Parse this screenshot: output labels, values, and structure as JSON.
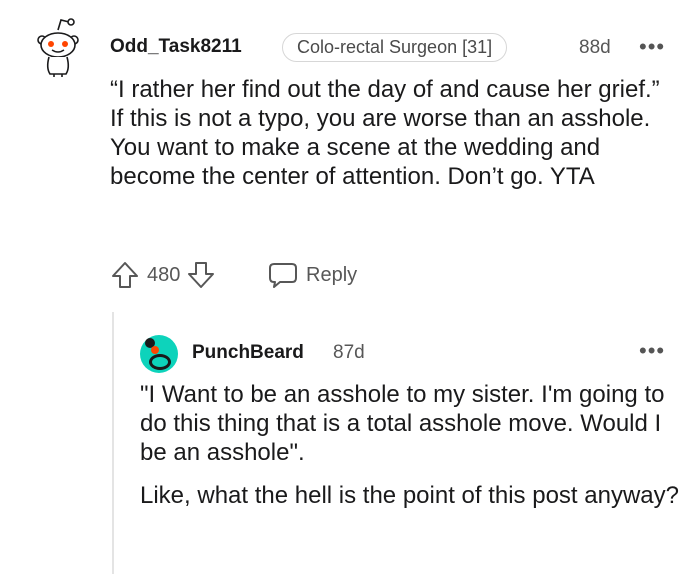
{
  "comment": {
    "username": "Odd_Task8211",
    "flair": "Colo-rectal Surgeon [31]",
    "age": "88d",
    "more_label": "•••",
    "paragraphs": [
      "“I rather her find out the day of and cause her grief.” If this is not a typo, you are worse than an asshole. You want to make a scene at the wedding and become the center of attention. Don’t go. YTA"
    ],
    "score": "480",
    "reply_label": "Reply"
  },
  "reply": {
    "username": "PunchBeard",
    "age": "87d",
    "more_label": "•••",
    "paragraphs": [
      "\"I Want to be an asshole to my sister. I'm going to do this thing that is a total asshole move. Would I be an asshole\".",
      "Like, what the hell is the point of this post anyway?"
    ]
  },
  "colors": {
    "reply_avatar": "#0dd3bb",
    "snoo_eye": "#ff4500"
  },
  "icons": {
    "avatar_1": "snoo-avatar-icon",
    "avatar_2": "snoo-avatar-icon",
    "upvote": "arrow-up-icon",
    "downvote": "arrow-down-icon",
    "reply": "speech-bubble-icon"
  }
}
